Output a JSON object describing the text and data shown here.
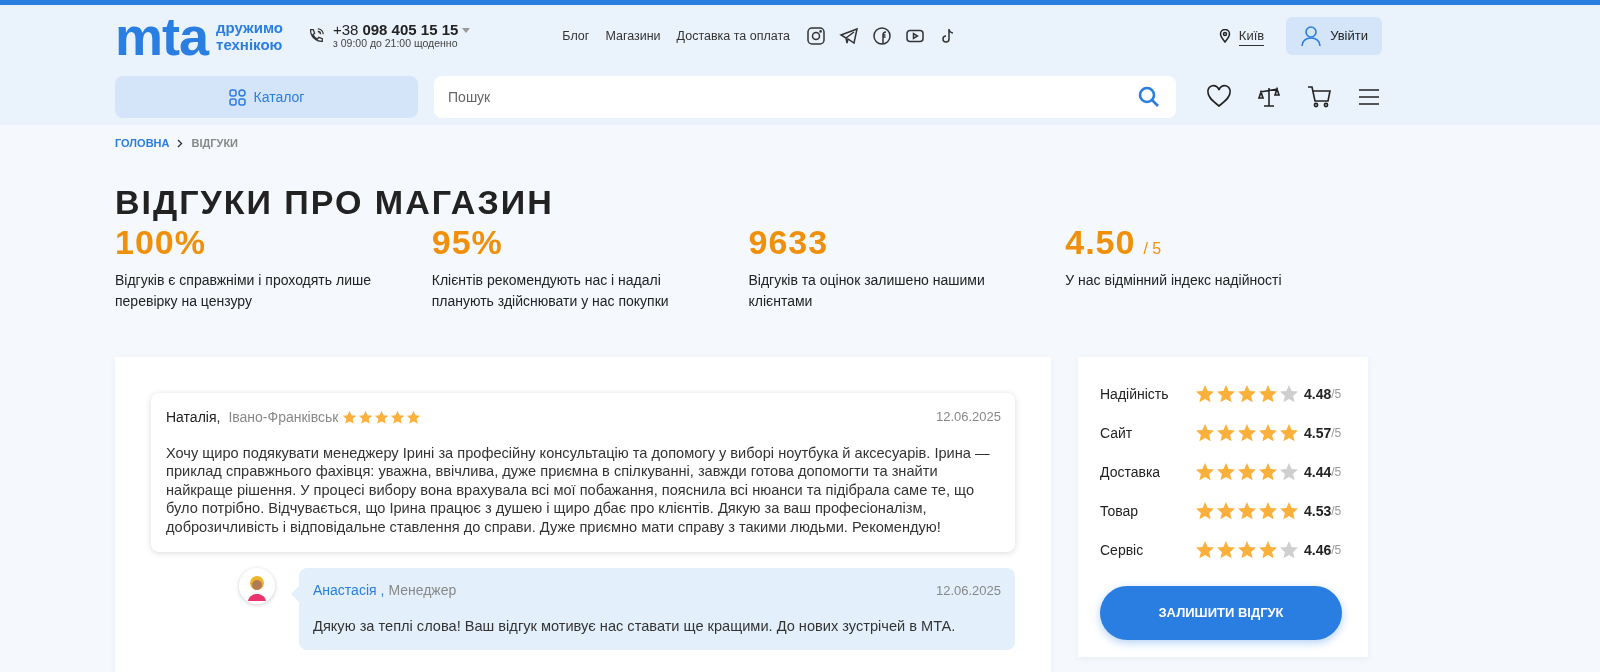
{
  "header": {
    "logo": {
      "mark": "mta",
      "tagline_1": "дружимо",
      "tagline_2": "технікою"
    },
    "phone": {
      "prefix": "+38",
      "number": "098 405 15 15",
      "hours": "з 09:00 до 21:00 щоденно"
    },
    "nav_links": [
      "Блог",
      "Магазини",
      "Доставка та оплата"
    ],
    "city": "Київ",
    "login": "Увійти",
    "catalog": "Каталог",
    "search": {
      "placeholder": "Пошук"
    }
  },
  "breadcrumb": [
    {
      "label": "ГОЛОВНА",
      "current": false
    },
    {
      "label": "ВІДГУКИ",
      "current": true
    }
  ],
  "title": "ВІДГУКИ ПРО МАГАЗИН",
  "stats": [
    {
      "value": "100%",
      "description": "Відгуків є справжніми і проходять лише перевірку на цензуру"
    },
    {
      "value": "95%",
      "description": "Клієнтів рекомендують нас і надалі планують здійснювати у нас покупки"
    },
    {
      "value": "9633",
      "description": "Відгуків та оцінок залишено нашими клієнтами"
    },
    {
      "value": "4.50",
      "suffix": "/ 5",
      "description": "У нас відмінний індекс надійності"
    }
  ],
  "review": {
    "author": "Наталія,",
    "city": "Івано-Франківськ",
    "stars": 5,
    "date": "12.06.2025",
    "text": "Хочу щиро подякувати менеджеру Ірині за професійну консультацію та допомогу у виборі ноутбука й аксесуарів. Ірина — приклад справжнього фахівця: уважна, ввічлива, дуже приємна в спілкуванні, завжди готова допомогти та знайти найкраще рішення. У процесі вибору вона врахувала всі мої побажання, пояснила всі нюанси та підібрала саме те, що було потрібно. Відчувається, що Ірина працює з душею і щиро дбає про клієнтів. Дякую за ваш професіоналізм, доброзичливість і відповідальне ставлення до справи. Дуже приємно мати справу з такими людьми. Рекомендую!"
  },
  "reply": {
    "author": "Анастасія ,",
    "role": "Менеджер",
    "date": "12.06.2025",
    "text": "Дякую за теплі слова! Ваш відгук мотивує нас ставати ще кращими. До нових зустрічей в МТА."
  },
  "ratings": [
    {
      "label": "Надійність",
      "stars": 4,
      "score": "4.48",
      "max": "/5"
    },
    {
      "label": "Сайт",
      "stars": 5,
      "score": "4.57",
      "max": "/5"
    },
    {
      "label": "Доставка",
      "stars": 4,
      "score": "4.44",
      "max": "/5"
    },
    {
      "label": "Товар",
      "stars": 5,
      "score": "4.53",
      "max": "/5"
    },
    {
      "label": "Сервіс",
      "stars": 4,
      "score": "4.46",
      "max": "/5"
    }
  ],
  "leave_review_button": "ЗАЛИШИТИ ВІДГУК"
}
